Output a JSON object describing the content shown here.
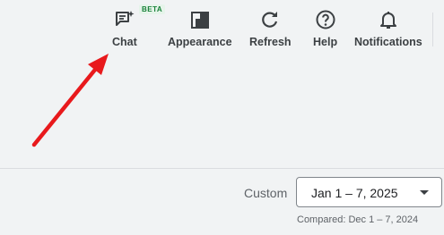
{
  "toolbar": {
    "chat": {
      "label": "Chat",
      "badge": "BETA",
      "icon": "chat-sparkle-icon"
    },
    "appearance": {
      "label": "Appearance",
      "icon": "appearance-icon"
    },
    "refresh": {
      "label": "Refresh",
      "icon": "refresh-icon"
    },
    "help": {
      "label": "Help",
      "icon": "help-icon"
    },
    "notifications": {
      "label": "Notifications",
      "icon": "bell-icon"
    }
  },
  "date_range": {
    "preset_label": "Custom",
    "selected": "Jan 1 – 7, 2025",
    "comparison": "Compared: Dec 1 – 7, 2024"
  },
  "annotation": {
    "arrow_color": "#e8191c",
    "target": "chat"
  },
  "colors": {
    "background": "#f1f3f4",
    "badge_bg": "#e6f4ea",
    "badge_text": "#188038"
  }
}
